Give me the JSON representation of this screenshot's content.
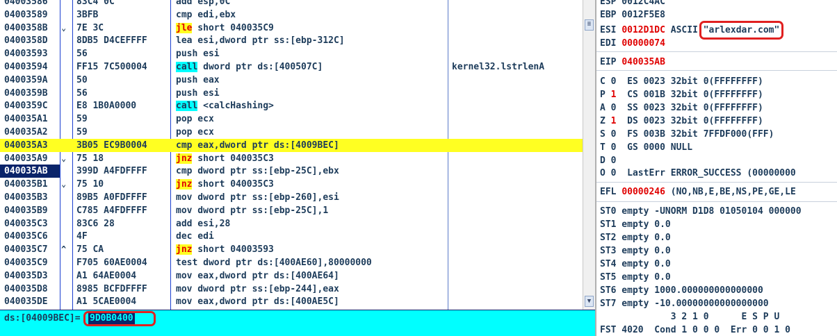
{
  "disasm": {
    "rows": [
      {
        "addr": "04003586",
        "hex": "83C4 0C",
        "asm": [
          {
            "t": "add esp,0C"
          }
        ],
        "comment": "",
        "jmp": ""
      },
      {
        "addr": "04003589",
        "hex": "3BFB",
        "asm": [
          {
            "t": "cmp edi,ebx"
          }
        ],
        "comment": "",
        "jmp": ""
      },
      {
        "addr": "0400358B",
        "hex": "7E 3C",
        "asm": [
          {
            "t": "jle",
            "k": "y"
          },
          {
            "t": " short 040035C9"
          }
        ],
        "comment": "",
        "jmp": "⌄"
      },
      {
        "addr": "0400358D",
        "hex": "8DB5 D4CEFFFF",
        "asm": [
          {
            "t": "lea esi,dword ptr ss:[ebp-312C]"
          }
        ],
        "comment": "",
        "jmp": ""
      },
      {
        "addr": "04003593",
        "hex": "56",
        "asm": [
          {
            "t": "push esi"
          }
        ],
        "comment": "",
        "jmp": ""
      },
      {
        "addr": "04003594",
        "hex": "FF15 7C500004",
        "asm": [
          {
            "t": "call",
            "k": "c"
          },
          {
            "t": " dword ptr ds:[400507C]"
          }
        ],
        "comment": "kernel32.lstrlenA",
        "jmp": ""
      },
      {
        "addr": "0400359A",
        "hex": "50",
        "asm": [
          {
            "t": "push eax"
          }
        ],
        "comment": "",
        "jmp": ""
      },
      {
        "addr": "0400359B",
        "hex": "56",
        "asm": [
          {
            "t": "push esi"
          }
        ],
        "comment": "",
        "jmp": ""
      },
      {
        "addr": "0400359C",
        "hex": "E8 1B0A0000",
        "asm": [
          {
            "t": "call",
            "k": "c"
          },
          {
            "t": " <calcHashing>"
          }
        ],
        "comment": "",
        "jmp": ""
      },
      {
        "addr": "040035A1",
        "hex": "59",
        "asm": [
          {
            "t": "pop ecx"
          }
        ],
        "comment": "",
        "jmp": ""
      },
      {
        "addr": "040035A2",
        "hex": "59",
        "asm": [
          {
            "t": "pop ecx"
          }
        ],
        "comment": "",
        "jmp": ""
      },
      {
        "addr": "040035A3",
        "hex": "3B05 EC9B0004",
        "asm": [
          {
            "t": "cmp eax,dword ptr ds:[4009BEC]"
          }
        ],
        "comment": "",
        "jmp": "",
        "selected": true
      },
      {
        "addr": "040035A9",
        "hex": "75 18",
        "asm": [
          {
            "t": "jnz",
            "k": "y"
          },
          {
            "t": " short 040035C3"
          }
        ],
        "comment": "",
        "jmp": "⌄"
      },
      {
        "addr": "040035AB",
        "hex": "399D A4FDFFFF",
        "asm": [
          {
            "t": "cmp dword ptr ss:[ebp-25C],ebx"
          }
        ],
        "comment": "",
        "jmp": "",
        "current": true
      },
      {
        "addr": "040035B1",
        "hex": "75 10",
        "asm": [
          {
            "t": "jnz",
            "k": "y"
          },
          {
            "t": " short 040035C3"
          }
        ],
        "comment": "",
        "jmp": "⌄"
      },
      {
        "addr": "040035B3",
        "hex": "89B5 A0FDFFFF",
        "asm": [
          {
            "t": "mov dword ptr ss:[ebp-260],esi"
          }
        ],
        "comment": "",
        "jmp": ""
      },
      {
        "addr": "040035B9",
        "hex": "C785 A4FDFFFF",
        "asm": [
          {
            "t": "mov dword ptr ss:[ebp-25C],1"
          }
        ],
        "comment": "",
        "jmp": ""
      },
      {
        "addr": "040035C3",
        "hex": "83C6 28",
        "asm": [
          {
            "t": "add esi,28"
          }
        ],
        "comment": "",
        "jmp": ""
      },
      {
        "addr": "040035C6",
        "hex": "4F",
        "asm": [
          {
            "t": "dec edi"
          }
        ],
        "comment": "",
        "jmp": ""
      },
      {
        "addr": "040035C7",
        "hex": "75 CA",
        "asm": [
          {
            "t": "jnz",
            "k": "y"
          },
          {
            "t": " short 04003593"
          }
        ],
        "comment": "",
        "jmp": "^"
      },
      {
        "addr": "040035C9",
        "hex": "F705 60AE0004",
        "asm": [
          {
            "t": "test dword ptr ds:[400AE60],80000000"
          }
        ],
        "comment": "",
        "jmp": ""
      },
      {
        "addr": "040035D3",
        "hex": "A1 64AE0004",
        "asm": [
          {
            "t": "mov eax,dword ptr ds:[400AE64]"
          }
        ],
        "comment": "",
        "jmp": ""
      },
      {
        "addr": "040035D8",
        "hex": "8985 BCFDFFFF",
        "asm": [
          {
            "t": "mov dword ptr ss:[ebp-244],eax"
          }
        ],
        "comment": "",
        "jmp": ""
      },
      {
        "addr": "040035DE",
        "hex": "A1 5CAE0004",
        "asm": [
          {
            "t": "mov eax,dword ptr ds:[400AE5C]"
          }
        ],
        "comment": "",
        "jmp": ""
      }
    ]
  },
  "info_pane": {
    "label": "ds:[04009BEC]=",
    "value": "9D0B0400"
  },
  "registers": {
    "lines": [
      [
        {
          "t": "ESP 0012C4AC"
        }
      ],
      [
        {
          "t": "EBP 0012F5E8"
        }
      ],
      [
        {
          "t": "ESI "
        },
        {
          "t": "0012D1DC",
          "red": true
        },
        {
          "t": " ASCII "
        },
        {
          "t": "\"arlexdar.com\"",
          "boxed": true
        }
      ],
      [
        {
          "t": "EDI "
        },
        {
          "t": "00000074",
          "red": true
        }
      ],
      [
        {
          "t": "EIP "
        },
        {
          "t": "040035AB",
          "red": true
        }
      ],
      [
        {
          "t": "C 0  ES 0023 32bit 0(FFFFFFFF)"
        }
      ],
      [
        {
          "t": "P "
        },
        {
          "t": "1",
          "red": true
        },
        {
          "t": "  CS 001B 32bit 0(FFFFFFFF)"
        }
      ],
      [
        {
          "t": "A 0  SS 0023 32bit 0(FFFFFFFF)"
        }
      ],
      [
        {
          "t": "Z "
        },
        {
          "t": "1",
          "red": true
        },
        {
          "t": "  DS 0023 32bit 0(FFFFFFFF)"
        }
      ],
      [
        {
          "t": "S 0  FS 003B 32bit 7FFDF000(FFF)"
        }
      ],
      [
        {
          "t": "T 0  GS 0000 NULL"
        }
      ],
      [
        {
          "t": "D 0"
        }
      ],
      [
        {
          "t": "O 0  LastErr ERROR_SUCCESS (00000000"
        }
      ],
      [
        {
          "t": "EFL "
        },
        {
          "t": "00000246",
          "red": true
        },
        {
          "t": " (NO,NB,E,BE,NS,PE,GE,LE"
        }
      ],
      [
        {
          "t": "ST0 empty -UNORM D1D8 01050104 000000"
        }
      ],
      [
        {
          "t": "ST1 empty 0.0"
        }
      ],
      [
        {
          "t": "ST2 empty 0.0"
        }
      ],
      [
        {
          "t": "ST3 empty 0.0"
        }
      ],
      [
        {
          "t": "ST4 empty 0.0"
        }
      ],
      [
        {
          "t": "ST5 empty 0.0"
        }
      ],
      [
        {
          "t": "ST6 empty 1000.000000000000000"
        }
      ],
      [
        {
          "t": "ST7 empty -10.00000000000000000"
        }
      ],
      [
        {
          "t": "             3 2 1 0      E S P U"
        }
      ],
      [
        {
          "t": "FST 4020  Cond 1 0 0 0  Err 0 0 1 0"
        }
      ]
    ]
  }
}
